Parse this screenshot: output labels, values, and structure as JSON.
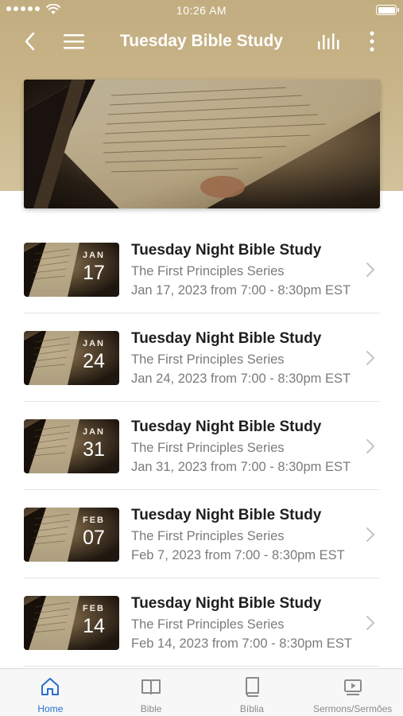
{
  "status_bar": {
    "time": "10:26 AM"
  },
  "nav": {
    "title": "Tuesday Bible Study"
  },
  "events": [
    {
      "month": "JAN",
      "day": "17",
      "title": "Tuesday Night Bible Study",
      "series": "The First Principles Series",
      "when": "Jan 17, 2023 from 7:00 - 8:30pm EST"
    },
    {
      "month": "JAN",
      "day": "24",
      "title": "Tuesday Night Bible Study",
      "series": "The First Principles Series",
      "when": "Jan 24, 2023 from 7:00 - 8:30pm EST"
    },
    {
      "month": "JAN",
      "day": "31",
      "title": "Tuesday Night Bible Study",
      "series": "The First Principles Series",
      "when": "Jan 31, 2023 from 7:00 - 8:30pm EST"
    },
    {
      "month": "FEB",
      "day": "07",
      "title": "Tuesday Night Bible Study",
      "series": "The First Principles Series",
      "when": "Feb 7, 2023 from 7:00 - 8:30pm EST"
    },
    {
      "month": "FEB",
      "day": "14",
      "title": "Tuesday Night Bible Study",
      "series": "The First Principles Series",
      "when": "Feb 14, 2023 from 7:00 - 8:30pm EST"
    }
  ],
  "tabs": [
    {
      "label": "Home",
      "icon": "home-icon",
      "active": true
    },
    {
      "label": "Bible",
      "icon": "open-book-icon",
      "active": false
    },
    {
      "label": "Bíblia",
      "icon": "closed-book-icon",
      "active": false
    },
    {
      "label": "Sermons/Sermões",
      "icon": "video-icon",
      "active": false
    }
  ],
  "colors": {
    "header_gold": "#c2ad80",
    "tab_active": "#2a6fcf",
    "tab_inactive": "#8a8a8a"
  }
}
